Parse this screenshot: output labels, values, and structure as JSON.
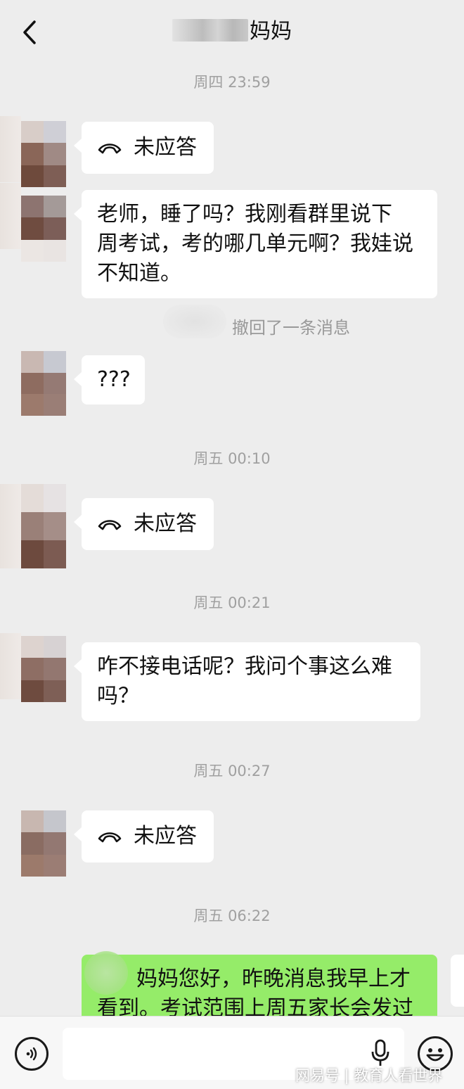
{
  "header": {
    "title_suffix": "妈妈",
    "back_icon": "chevron-left-icon"
  },
  "messages": {
    "t1": "周四 23:59",
    "call1": "未应答",
    "text1": "老师，睡了吗？我刚看群里说下周考试，考的哪几单元啊？我娃说不知道。",
    "text1_lines": [
      "老师，睡了吗？我刚看群里说下",
      "周考试，考的哪几单元啊？我娃说",
      "不知道。"
    ],
    "recall": "撤回了一条消息",
    "text2": "???",
    "t2": "周五 00:10",
    "call2": "未应答",
    "t3": "周五 00:21",
    "text3_lines": [
      "咋不接电话呢？我问个事这么难",
      "吗？"
    ],
    "t4": "周五 00:27",
    "call3": "未应答",
    "t5": "周五 06:22",
    "reply_lines": [
      "妈妈您好，昨晚消息我早上才",
      "看到。考试范围上周五家长会发过"
    ]
  },
  "footer": {
    "watermark": "网易号 | 教育人看世界"
  },
  "colors": {
    "background": "#ededed",
    "bubble_other": "#ffffff",
    "bubble_mine": "#95ec69",
    "timestamp": "#a0a0a0"
  }
}
